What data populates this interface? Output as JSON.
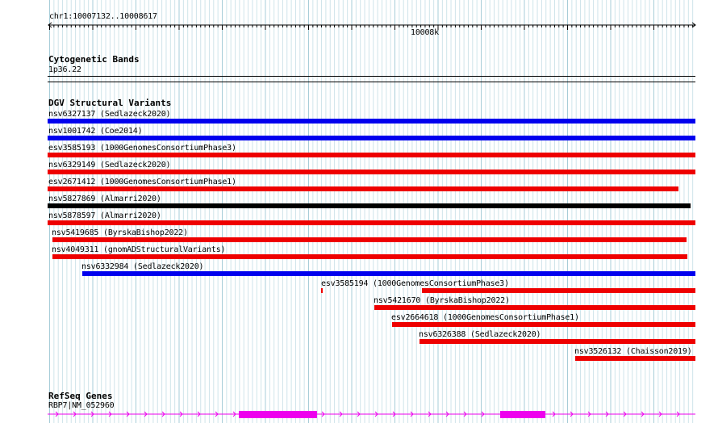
{
  "ruler": {
    "location": "chr1:10007132..10008617",
    "tick_label": "10008k"
  },
  "cyto": {
    "title": "Cytogenetic Bands",
    "band": "1p36.22"
  },
  "dgv": {
    "title": "DGV Structural Variants",
    "variants": [
      {
        "label": "nsv6327137 (Sedlazeck2020)",
        "color": "#0000ee"
      },
      {
        "label": "nsv1001742 (Coe2014)",
        "color": "#0000ee"
      },
      {
        "label": "esv3585193 (1000GenomesConsortiumPhase3)",
        "color": "#ee0000"
      },
      {
        "label": "nsv6329149 (Sedlazeck2020)",
        "color": "#ee0000"
      },
      {
        "label": "esv2671412 (1000GenomesConsortiumPhase1)",
        "color": "#ee0000"
      },
      {
        "label": "nsv5827869 (Almarri2020)",
        "color": "#000000"
      },
      {
        "label": "nsv5878597 (Almarri2020)",
        "color": "#ee0000"
      },
      {
        "label": "nsv5419685 (ByrskaBishop2022)",
        "color": "#ee0000"
      },
      {
        "label": "nsv4049311 (gnomADStructuralVariants)",
        "color": "#ee0000"
      },
      {
        "label": "nsv6332984 (Sedlazeck2020)",
        "color": "#0000ee"
      },
      {
        "label": "esv3585194 (1000GenomesConsortiumPhase3)",
        "color": "#ee0000"
      },
      {
        "label": "nsv5421670 (ByrskaBishop2022)",
        "color": "#ee0000"
      },
      {
        "label": "esv2664618 (1000GenomesConsortiumPhase1)",
        "color": "#ee0000"
      },
      {
        "label": "nsv6326388 (Sedlazeck2020)",
        "color": "#ee0000"
      },
      {
        "label": "nsv3526132 (Chaisson2019)",
        "color": "#ee0000"
      }
    ]
  },
  "refseq": {
    "title": "RefSeq Genes",
    "gene": "RBP7|NM_052960",
    "color": "#ee00ee"
  }
}
